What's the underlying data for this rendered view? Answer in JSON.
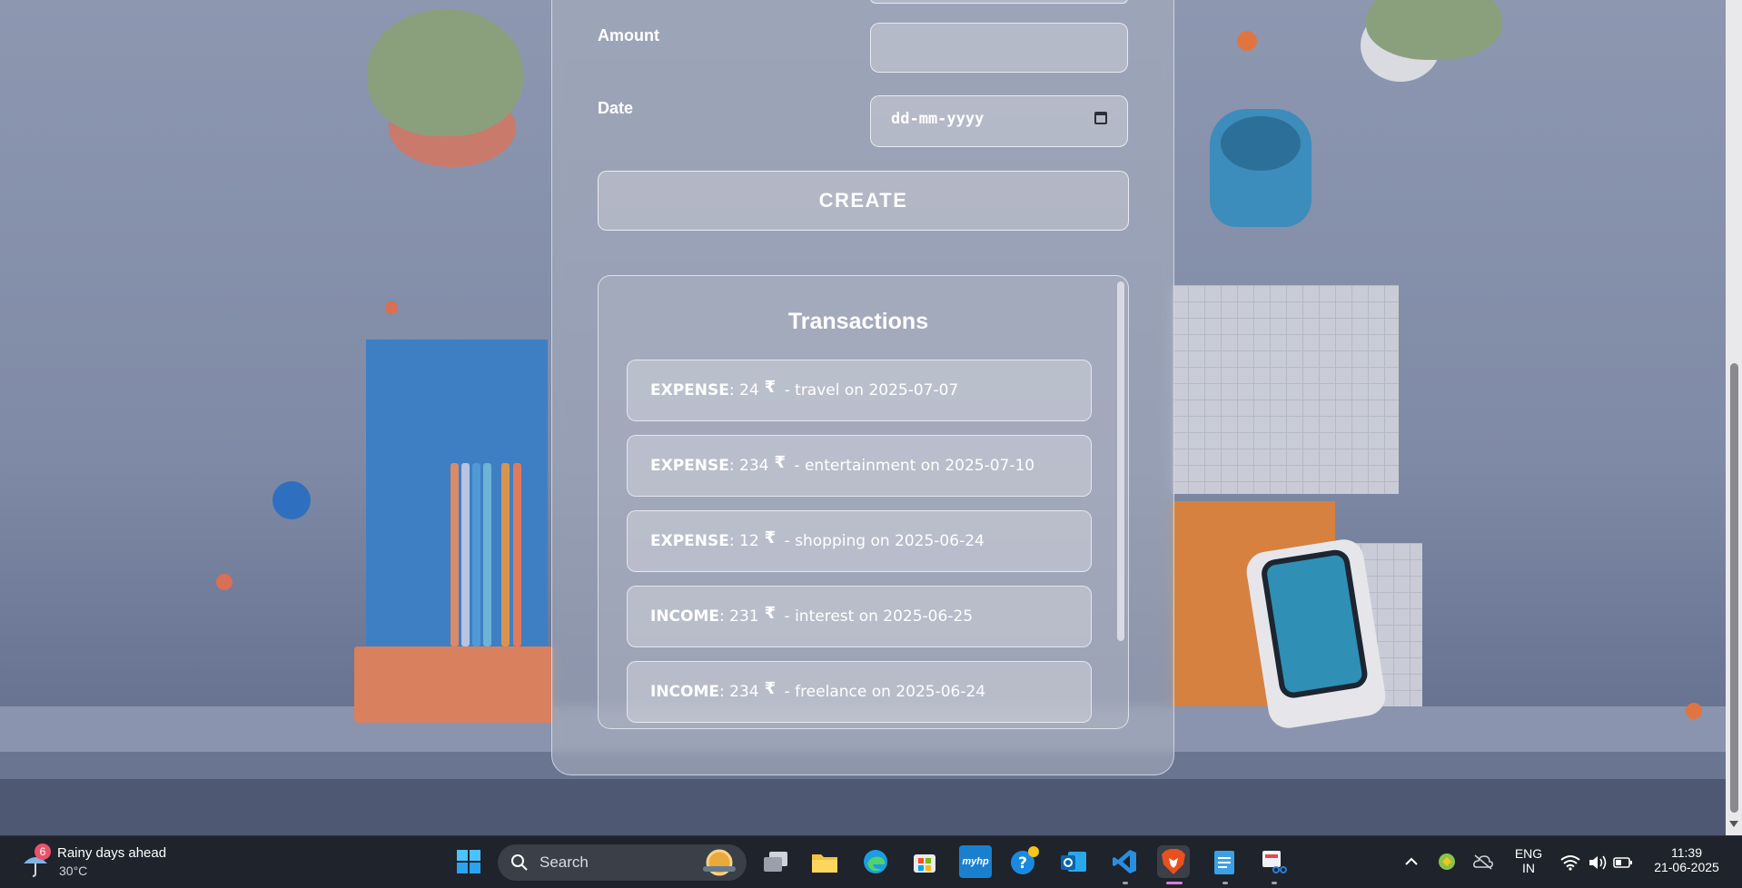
{
  "form": {
    "amount_label": "Amount",
    "amount_value": "",
    "date_label": "Date",
    "date_placeholder": "dd-mm-yyyy",
    "create_label": "CREATE"
  },
  "transactions": {
    "title": "Transactions",
    "currency_symbol": "₹",
    "items": [
      {
        "type": "EXPENSE",
        "amount": "24",
        "detail": "- travel on 2025-07-07"
      },
      {
        "type": "EXPENSE",
        "amount": "234",
        "detail": "- entertainment on 2025-07-10"
      },
      {
        "type": "EXPENSE",
        "amount": "12",
        "detail": "- shopping on 2025-06-24"
      },
      {
        "type": "INCOME",
        "amount": "231",
        "detail": "- interest on 2025-06-25"
      },
      {
        "type": "INCOME",
        "amount": "234",
        "detail": "- freelance on 2025-06-24"
      }
    ]
  },
  "taskbar": {
    "weather_badge": "6",
    "weather_title": "Rainy days ahead",
    "weather_temp": "30°C",
    "search_label": "Search",
    "lang_line1": "ENG",
    "lang_line2": "IN",
    "time": "11:39",
    "date": "21-06-2025",
    "apps": [
      "start-icon",
      "task-view-icon",
      "file-explorer-icon",
      "edge-icon",
      "store-icon",
      "myhp-icon",
      "get-help-icon",
      "outlook-icon",
      "vscode-icon",
      "brave-icon",
      "notepad-icon",
      "snipping-tool-icon"
    ],
    "myhp_label": "myhp"
  },
  "colors": {
    "accent_brave": "#e8501f",
    "badge": "#e8536b",
    "taskbar_bg": "#1f232b"
  }
}
